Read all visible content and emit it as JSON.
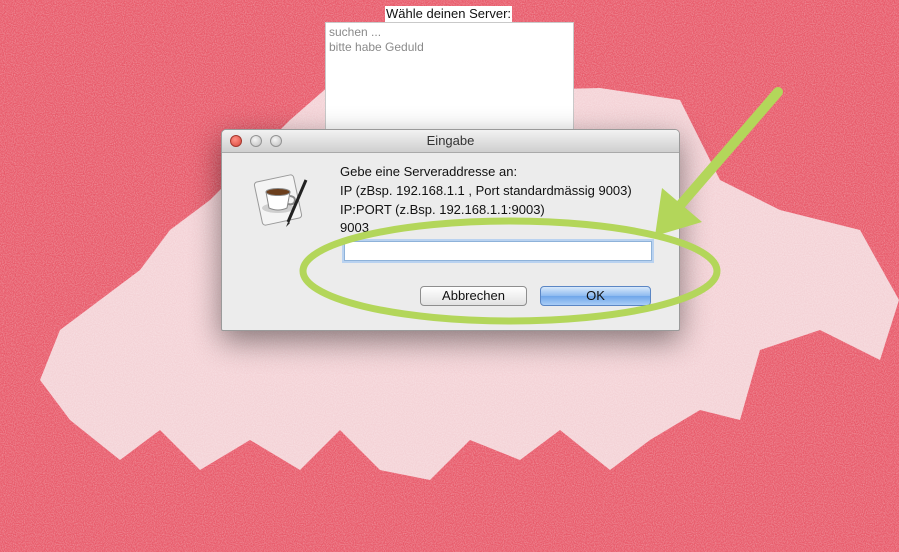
{
  "server_window": {
    "title": "Wähle deinen Server:",
    "items": [
      "suchen ...",
      "bitte habe Geduld"
    ]
  },
  "dialog": {
    "title": "Eingabe",
    "icon": "java-coffee-cup-icon",
    "message_lines": [
      "Gebe eine Serveraddresse an:",
      " IP (zBsp. 192.168.1.1 , Port standardmässig 9003)",
      " IP:PORT (z.Bsp. 192.168.1.1:9003)",
      " 9003"
    ],
    "input_value": "",
    "cancel_label": "Abbrechen",
    "ok_label": "OK"
  },
  "annotation": {
    "arrow_color": "#b3d65a",
    "ellipse_color": "#b3d65a"
  },
  "colors": {
    "background": "#e85a6a",
    "map": "#f7e6e8"
  }
}
